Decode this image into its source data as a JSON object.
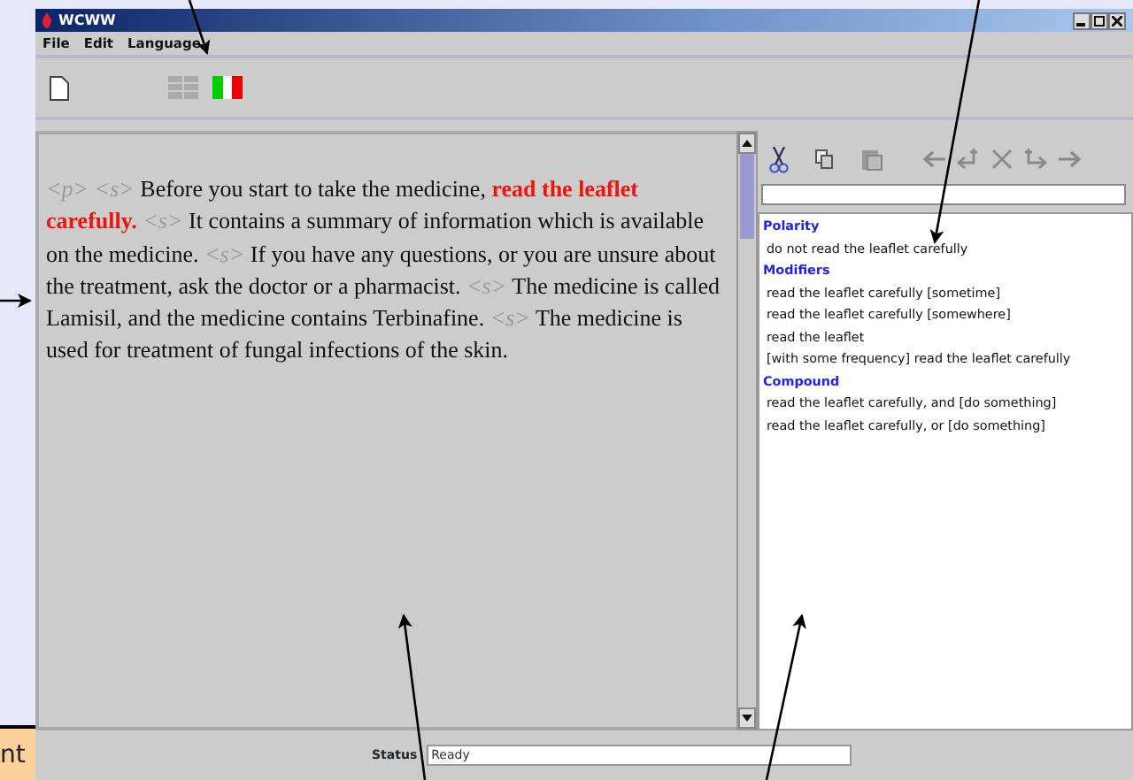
{
  "window": {
    "title": "WCWW"
  },
  "menu": [
    {
      "label": "File"
    },
    {
      "label": "Edit"
    },
    {
      "label": "Language"
    }
  ],
  "document": {
    "segments": [
      {
        "kind": "tag",
        "text": "<p>"
      },
      {
        "kind": "tag",
        "text": "<s>"
      },
      {
        "kind": "text",
        "text": "Before you start to take the medicine,"
      },
      {
        "kind": "highlight",
        "text": "read the leaflet carefully."
      },
      {
        "kind": "tag",
        "text": "<s>"
      },
      {
        "kind": "text",
        "text": "It contains a summary of information which is available on the medicine."
      },
      {
        "kind": "tag",
        "text": "<s>"
      },
      {
        "kind": "text",
        "text": "If you have any questions, or you are unsure about the treatment, ask the doctor or a pharmacist."
      },
      {
        "kind": "tag",
        "text": "<s>"
      },
      {
        "kind": "text",
        "text": "The medicine is called Lamisil, and the medicine contains Terbinafine."
      },
      {
        "kind": "tag",
        "text": "<s>"
      },
      {
        "kind": "text",
        "text": "The medicine is used for treatment of fungal infections of the skin."
      }
    ]
  },
  "variants": [
    {
      "heading": "Polarity",
      "items": [
        "do not read the leaflet carefully"
      ]
    },
    {
      "heading": "Modifiers",
      "items": [
        "read the leaflet carefully [sometime]",
        "read the leaflet carefully [somewhere]",
        "read the leaflet",
        "[with some frequency] read the leaflet carefully"
      ]
    },
    {
      "heading": "Compound",
      "items": [
        "read the leaflet carefully, and [do something]",
        "read the leaflet carefully, or [do something]"
      ]
    }
  ],
  "status_bar": {
    "label": "Status",
    "value": "Ready"
  },
  "side_tab": {
    "text": "nt"
  }
}
